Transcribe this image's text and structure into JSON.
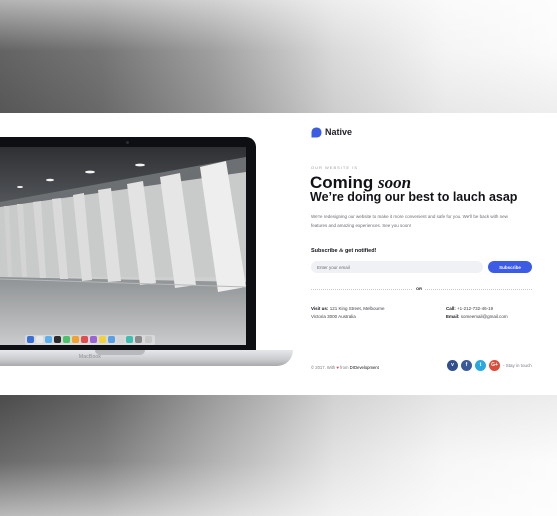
{
  "brand": {
    "name": "Native"
  },
  "hero": {
    "eyebrow": "OUR WEBSITE IS",
    "headline_word": "Coming",
    "headline_italic": "soon",
    "subhead": "We’re doing our best to lauch asap",
    "description": "We're redesigning our website to make it more convenient and safe for you. We'll be back with new features and amazing experiences. See you soon!"
  },
  "subscribe": {
    "label_prefix": "Subscribe",
    "label_italic": "&",
    "label_suffix": "get notified!",
    "placeholder": "Enter your email",
    "button_label": "Subscribe"
  },
  "divider": {
    "label": "OR"
  },
  "contact": {
    "visit_label": "Visit us:",
    "address_line1": "121 King Street, Melbourne",
    "address_line2": "Victoria 3000 Australia",
    "call_label": "Call:",
    "phone": "+1-212-732-46-19",
    "email_label": "Email:",
    "email": "someemail@gmail.com"
  },
  "footer": {
    "copyright": "© 2017. With",
    "from_text": "from",
    "company": "DrDevelopment",
    "stay": "- Stay in touch"
  },
  "laptop": {
    "label": "MacBook"
  },
  "social": [
    {
      "name": "vimeo",
      "glyph": "v",
      "color": "#2f4f8f"
    },
    {
      "name": "facebook",
      "glyph": "f",
      "color": "#3b5998"
    },
    {
      "name": "twitter",
      "glyph": "t",
      "color": "#2aa9e0"
    },
    {
      "name": "google-plus",
      "glyph": "G+",
      "color": "#dd4b39"
    }
  ],
  "colors": {
    "accent": "#3d5ce6",
    "heart": "#e23d4a"
  }
}
